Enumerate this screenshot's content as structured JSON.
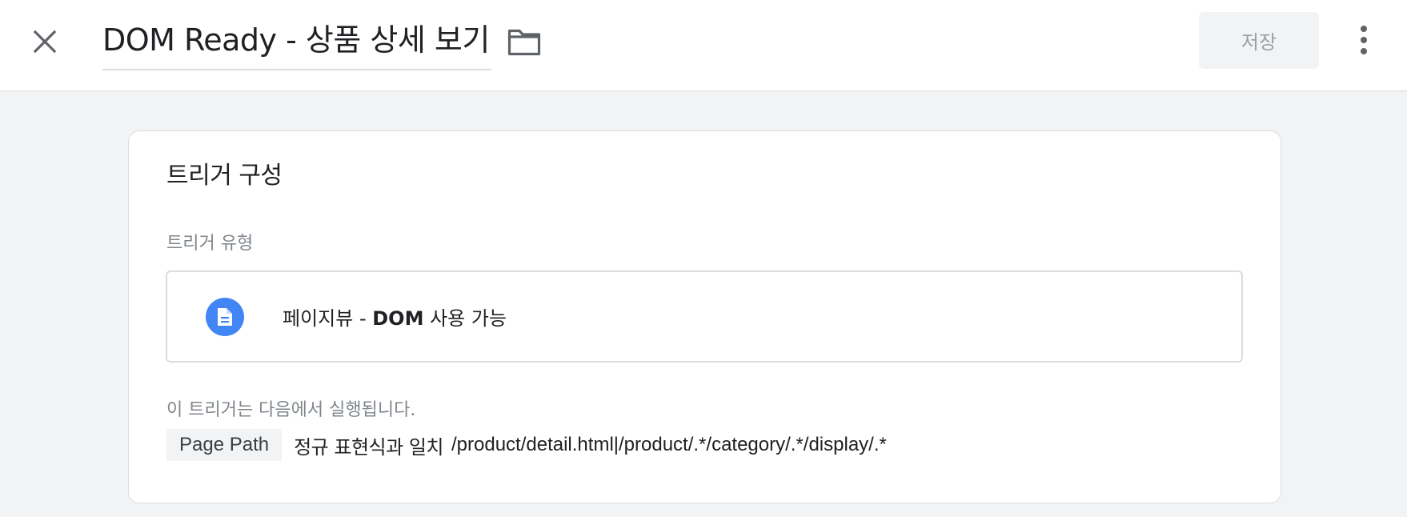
{
  "header": {
    "title": "DOM Ready - 상품 상세 보기",
    "save_label": "저장",
    "close_icon": "close-icon",
    "folder_icon": "folder-icon",
    "more_icon": "more-vertical-icon"
  },
  "trigger_config": {
    "title": "트리거 구성",
    "type_label": "트리거 유형",
    "type": {
      "icon": "document-icon",
      "icon_color": "#4285f4",
      "name_prefix": "페이지뷰 - ",
      "name_bold": "DOM",
      "name_suffix": " 사용 가능"
    },
    "fires_on_label": "이 트리거는 다음에서 실행됩니다.",
    "condition": {
      "variable": "Page Path",
      "operator": "정규 표현식과 일치",
      "value": "/product/detail.html|/product/.*/category/.*/display/.*"
    }
  }
}
